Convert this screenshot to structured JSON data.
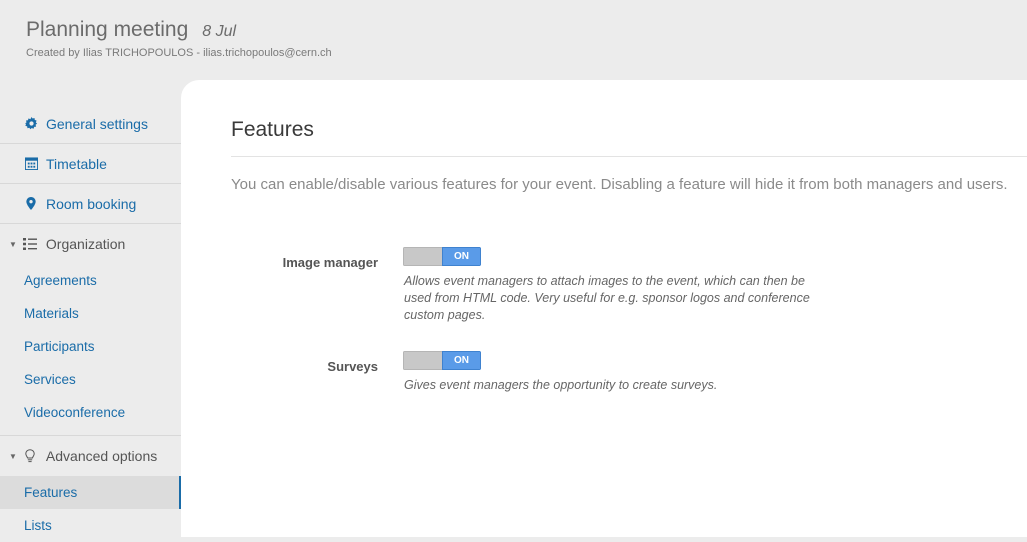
{
  "header": {
    "title": "Planning meeting",
    "date": "8 Jul",
    "creator": "Created by Ilias TRICHOPOULOS - ilias.trichopoulos@cern.ch"
  },
  "sidebar": {
    "top_items": [
      {
        "label": "General settings",
        "icon": "gear-icon"
      },
      {
        "label": "Timetable",
        "icon": "calendar-icon"
      },
      {
        "label": "Room booking",
        "icon": "map-pin-icon"
      }
    ],
    "organization": {
      "label": "Organization",
      "icon": "list-icon",
      "items": [
        "Agreements",
        "Materials",
        "Participants",
        "Services",
        "Videoconference"
      ]
    },
    "advanced": {
      "label": "Advanced options",
      "icon": "lightbulb-icon",
      "items": [
        "Features",
        "Lists"
      ],
      "active": "Features"
    }
  },
  "main": {
    "title": "Features",
    "intro": "You can enable/disable various features for your event. Disabling a feature will hide it from both managers and users.",
    "features": [
      {
        "label": "Image manager",
        "state": "ON",
        "description": "Allows event managers to attach images to the event, which can then be used from HTML code. Very useful for e.g. sponsor logos and conference custom pages."
      },
      {
        "label": "Surveys",
        "state": "ON",
        "description": "Gives event managers the opportunity to create surveys."
      }
    ]
  },
  "colors": {
    "link": "#1a6ca8",
    "toggle_on": "#5a9be8",
    "toggle_off": "#c8c8c8"
  }
}
